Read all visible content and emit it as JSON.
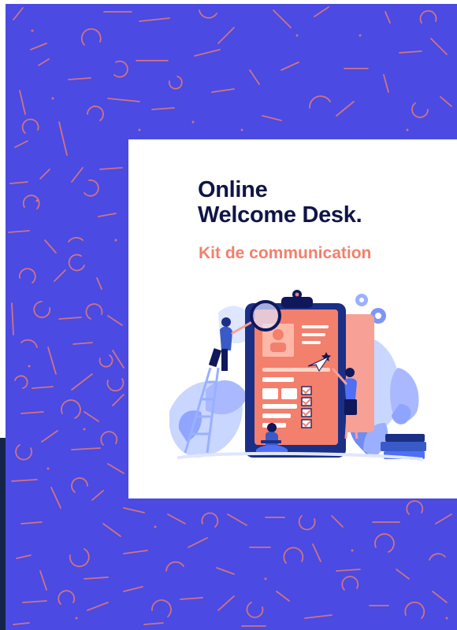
{
  "card": {
    "title_line1": "Online",
    "title_line2": "Welcome Desk.",
    "subtitle": "Kit de communication"
  },
  "colors": {
    "background": "#4b4ae2",
    "pattern": "#f37f6d",
    "title": "#0f1546",
    "accent": "#f37f6d",
    "dark_edge": "#14244a",
    "card": "#ffffff"
  },
  "illustration": {
    "name": "clipboard-checklist-team-illustration"
  }
}
